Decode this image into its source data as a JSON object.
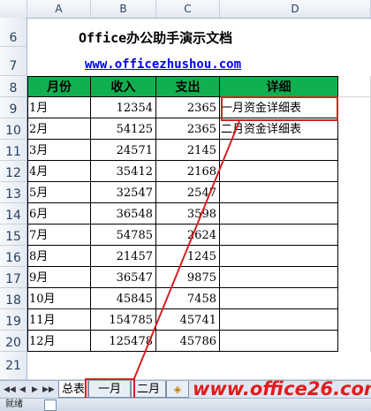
{
  "columns": [
    "A",
    "B",
    "C",
    "D"
  ],
  "rows": [
    "6",
    "7",
    "8",
    "9",
    "10",
    "11",
    "12",
    "13",
    "14",
    "15",
    "16",
    "17",
    "18",
    "19",
    "20",
    "21"
  ],
  "sheet": {
    "title": "Office办公助手演示文档",
    "link": "www.officezhushou.com",
    "headers": [
      "月份",
      "收入",
      "支出",
      "详细"
    ],
    "data": [
      {
        "month": "1月",
        "income": "12354",
        "expense": "2365",
        "detail": "一月资金详细表"
      },
      {
        "month": "2月",
        "income": "54125",
        "expense": "2365",
        "detail": "二月资金详细表"
      },
      {
        "month": "3月",
        "income": "24571",
        "expense": "2145",
        "detail": ""
      },
      {
        "month": "4月",
        "income": "35412",
        "expense": "2168",
        "detail": ""
      },
      {
        "month": "5月",
        "income": "32547",
        "expense": "2547",
        "detail": ""
      },
      {
        "month": "6月",
        "income": "36548",
        "expense": "3598",
        "detail": ""
      },
      {
        "month": "7月",
        "income": "54785",
        "expense": "2624",
        "detail": ""
      },
      {
        "month": "8月",
        "income": "21457",
        "expense": "1245",
        "detail": ""
      },
      {
        "month": "9月",
        "income": "36547",
        "expense": "9875",
        "detail": ""
      },
      {
        "month": "10月",
        "income": "45845",
        "expense": "7458",
        "detail": ""
      },
      {
        "month": "11月",
        "income": "154785",
        "expense": "45741",
        "detail": ""
      },
      {
        "month": "12月",
        "income": "125478",
        "expense": "45786",
        "detail": ""
      }
    ]
  },
  "tabs": [
    "总表",
    "一月",
    "二月"
  ],
  "status": {
    "ready": "就绪"
  },
  "watermark": "www.office26.com",
  "colors": {
    "header_green": "#10b050",
    "highlight_red": "#d42020",
    "link_blue": "#0000ee"
  }
}
